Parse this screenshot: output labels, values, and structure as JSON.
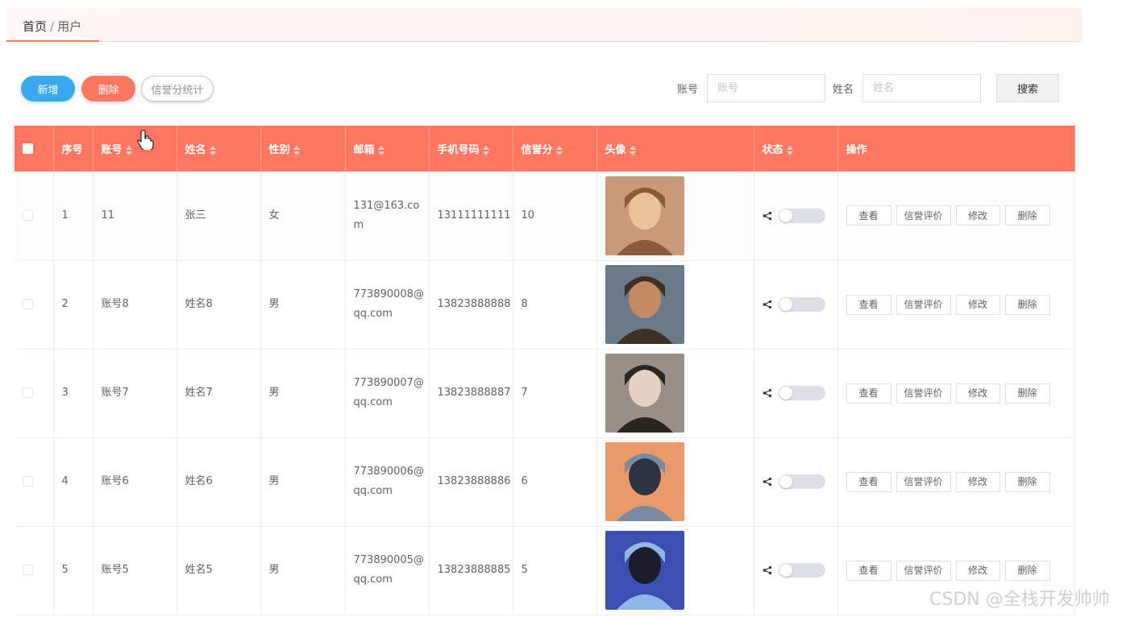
{
  "breadcrumb": {
    "home": "首页",
    "separator": "/",
    "current": "用户"
  },
  "toolbar": {
    "add_label": "新增",
    "delete_label": "删除",
    "stats_label": "信誉分统计"
  },
  "search": {
    "account_label": "账号",
    "account_placeholder": "账号",
    "name_label": "姓名",
    "name_placeholder": "姓名",
    "button_label": "搜索"
  },
  "table": {
    "headers": [
      "序号",
      "账号",
      "姓名",
      "性别",
      "邮箱",
      "手机号码",
      "信誉分",
      "头像",
      "状态",
      "操作"
    ],
    "rows": [
      {
        "index": "1",
        "account": "11",
        "name": "张三",
        "gender": "女",
        "email": "131@163.com",
        "phone": "13111111111",
        "score": "10",
        "avatar_colors": [
          "#c99a7a",
          "#8a5a3a",
          "#e8c39a"
        ]
      },
      {
        "index": "2",
        "account": "账号8",
        "name": "姓名8",
        "gender": "男",
        "email": "773890008@qq.com",
        "phone": "13823888888",
        "score": "8",
        "avatar_colors": [
          "#6b7a88",
          "#3d3028",
          "#c48a62"
        ]
      },
      {
        "index": "3",
        "account": "账号7",
        "name": "姓名7",
        "gender": "男",
        "email": "773890007@qq.com",
        "phone": "13823888887",
        "score": "7",
        "avatar_colors": [
          "#9a8f86",
          "#2b2522",
          "#e6d2c2"
        ]
      },
      {
        "index": "4",
        "account": "账号6",
        "name": "姓名6",
        "gender": "男",
        "email": "773890006@qq.com",
        "phone": "13823888886",
        "score": "6",
        "avatar_colors": [
          "#e89a6a",
          "#7a8aa0",
          "#2e3440"
        ]
      },
      {
        "index": "5",
        "account": "账号5",
        "name": "姓名5",
        "gender": "男",
        "email": "773890005@qq.com",
        "phone": "13823888885",
        "score": "5",
        "avatar_colors": [
          "#3a4fb0",
          "#8fb6e8",
          "#1b1e2a"
        ]
      }
    ],
    "actions": {
      "view": "查看",
      "rate": "信誉评价",
      "edit": "修改",
      "delete": "删除"
    }
  },
  "watermark": "CSDN @全栈开发帅帅",
  "colors": {
    "accent": "#ff7761",
    "primary": "#3aa9ec"
  }
}
